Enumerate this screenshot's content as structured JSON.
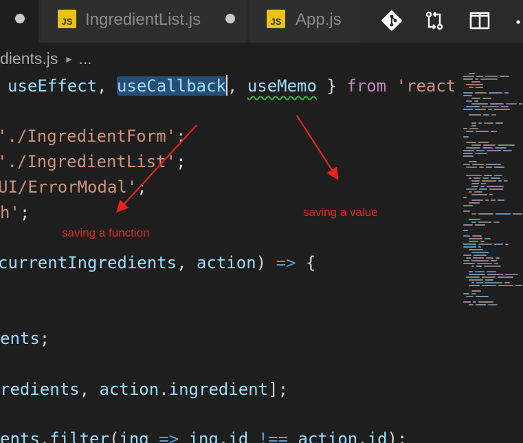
{
  "tabs": [
    {
      "label": ""
    },
    {
      "label": "IngredientList.js",
      "badge": "JS"
    },
    {
      "label": "App.js",
      "badge": "JS"
    }
  ],
  "toolbar": {
    "icons": [
      "git-icon",
      "compare-changes-icon",
      "split-editor-icon",
      "more-icon"
    ],
    "more_label": "·"
  },
  "breadcrumb": {
    "file": "dients.js",
    "separator": "▸",
    "ellipsis": "..."
  },
  "code": {
    "line1": {
      "a": "useEffect",
      "b": ", ",
      "c": "useCallback",
      "d": ", ",
      "e": "useMemo",
      "f": " } ",
      "g": "from",
      "h": " 'react"
    },
    "line2": {
      "str": "'./IngredientForm'",
      "end": ";"
    },
    "line3": {
      "str": "'./IngredientList'",
      "end": ";"
    },
    "line4": {
      "str": "UI/ErrorModal'",
      "end": ";"
    },
    "line5": {
      "str": "h'",
      "end": ";"
    },
    "line6": {
      "a": "currentIngredients",
      "b": ", ",
      "c": "action",
      "d": ") ",
      "e": "=>",
      "f": " {"
    },
    "line7": {
      "a": "ents",
      "b": ";"
    },
    "line8": {
      "a": "redients",
      "b": ", ",
      "c": "action",
      "d": ".",
      "e": "ingredient",
      "f": "];"
    },
    "line9": {
      "a": "ents",
      "b": ".",
      "c": "filter",
      "d": "(",
      "e": "ing",
      "f": " => ",
      "g": "ing",
      "h": ".",
      "i": "id",
      "j": " !== ",
      "k": "action",
      "l": ".",
      "m": "id",
      "n": ");"
    }
  },
  "annotations": {
    "function_label": "saving a function",
    "value_label": "saving a value"
  },
  "colors": {
    "background": "#1e1e1e",
    "keyword": "#c586c0",
    "string": "#ce9178",
    "variable": "#9cdcfe",
    "selection": "#264f78",
    "annotation": "#e8231c",
    "js_badge": "#e8c11c"
  }
}
